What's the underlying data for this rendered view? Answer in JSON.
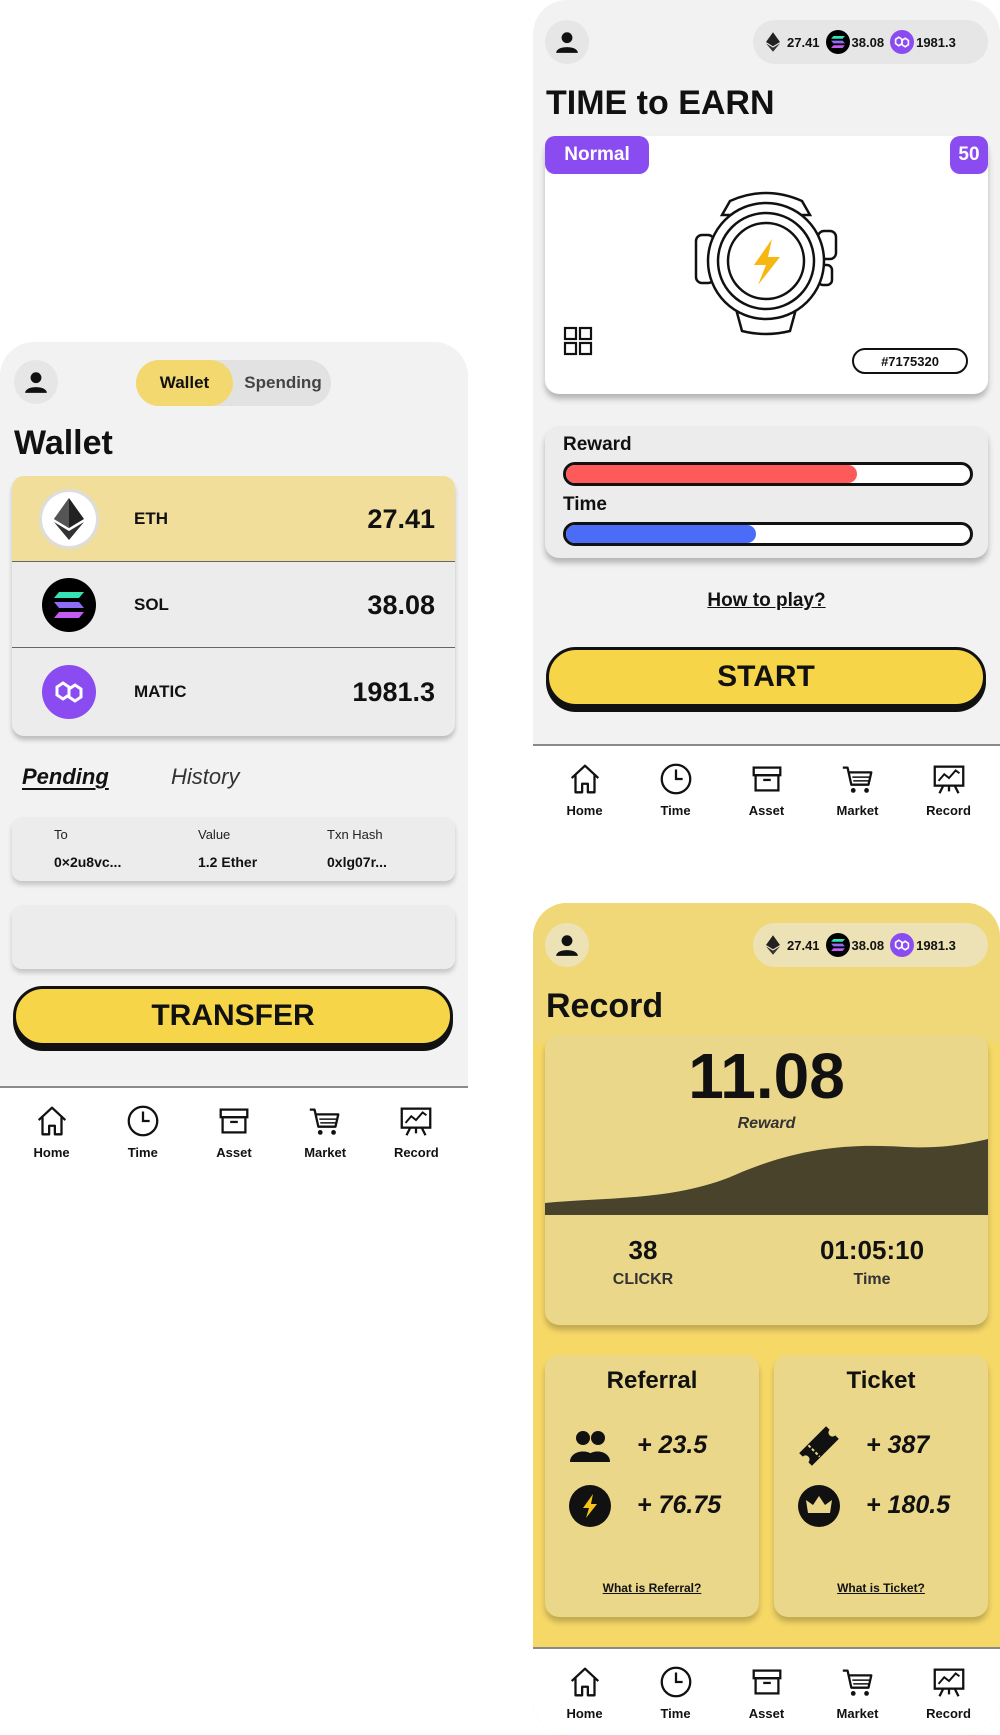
{
  "wallet_screen": {
    "segment": {
      "wallet_label": "Wallet",
      "spending_label": "Spending"
    },
    "title": "Wallet",
    "tokens": [
      {
        "symbol": "ETH",
        "amount": "27.41",
        "icon": "eth-icon"
      },
      {
        "symbol": "SOL",
        "amount": "38.08",
        "icon": "sol-icon"
      },
      {
        "symbol": "MATIC",
        "amount": "1981.3",
        "icon": "matic-icon"
      }
    ],
    "tabs": {
      "pending": "Pending",
      "history": "History"
    },
    "txn": {
      "headers": {
        "to": "To",
        "value": "Value",
        "hash": "Txn Hash"
      },
      "row": {
        "to": "0×2u8vc...",
        "value": "1.2 Ether",
        "hash": "0xlg07r..."
      }
    },
    "transfer_label": "TRANSFER"
  },
  "earn_screen": {
    "balances": {
      "eth": "27.41",
      "sol": "38.08",
      "matic": "1981.3"
    },
    "title": "TIME to EARN",
    "mode": "Normal",
    "level": "50",
    "watch_id": "#7175320",
    "reward_label": "Reward",
    "reward_fill": 0.72,
    "time_label": "Time",
    "time_fill": 0.47,
    "how_to_play": "How to play?",
    "start_label": "START"
  },
  "record_screen": {
    "balances": {
      "eth": "27.41",
      "sol": "38.08",
      "matic": "1981.3"
    },
    "title": "Record",
    "reward_value": "11.08",
    "reward_label": "Reward",
    "clickr_value": "38",
    "clickr_label": "CLICKR",
    "time_value": "01:05:10",
    "time_label": "Time",
    "referral": {
      "title": "Referral",
      "people_value": "+ 23.5",
      "energy_value": "+ 76.75",
      "link": "What is Referral?"
    },
    "ticket": {
      "title": "Ticket",
      "ticket_value": "+ 387",
      "crown_value": "+ 180.5",
      "link": "What is Ticket?"
    }
  },
  "nav": {
    "home": "Home",
    "time": "Time",
    "asset": "Asset",
    "market": "Market",
    "record": "Record"
  },
  "colors": {
    "accent_yellow": "#f6d648",
    "purple": "#8a4cf0",
    "reward_red": "#ff5a5a",
    "time_blue": "#4a6cf7"
  }
}
